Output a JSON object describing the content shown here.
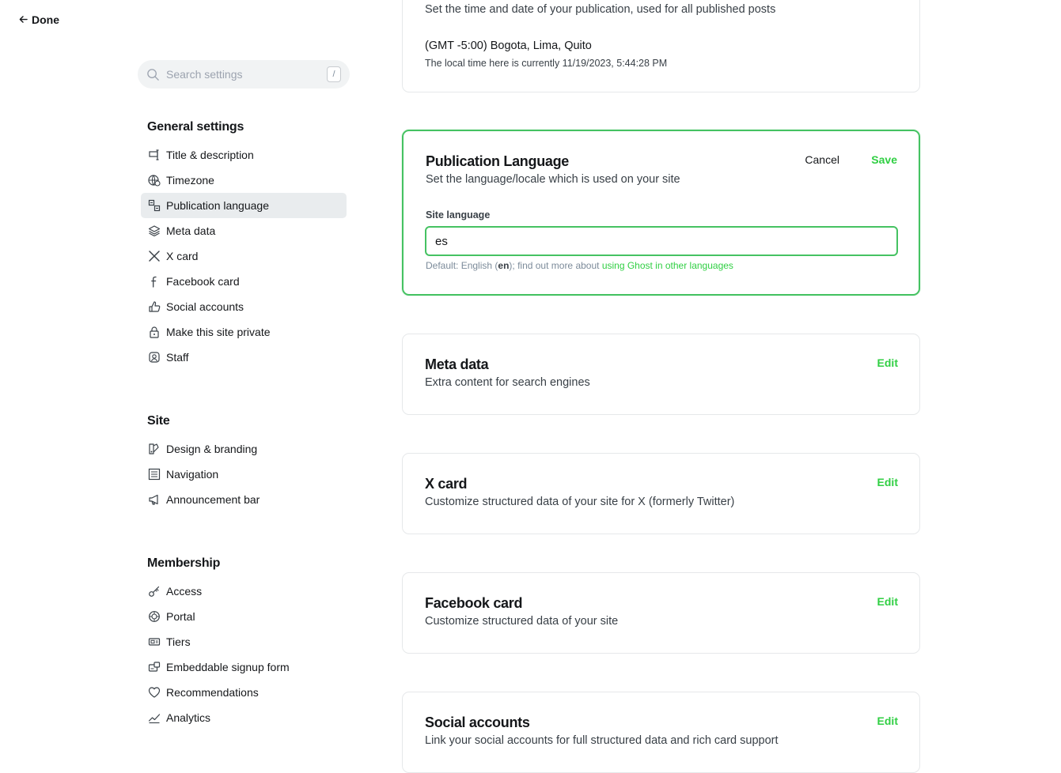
{
  "header": {
    "done_label": "Done"
  },
  "search": {
    "placeholder": "Search settings",
    "shortcut": "/"
  },
  "sidebar": {
    "groups": [
      {
        "title": "General settings",
        "items": [
          {
            "label": "Title & description",
            "icon": "title-icon"
          },
          {
            "label": "Timezone",
            "icon": "globe-clock-icon"
          },
          {
            "label": "Publication language",
            "icon": "translate-icon",
            "active": true
          },
          {
            "label": "Meta data",
            "icon": "layers-icon"
          },
          {
            "label": "X card",
            "icon": "x-logo-icon"
          },
          {
            "label": "Facebook card",
            "icon": "facebook-icon"
          },
          {
            "label": "Social accounts",
            "icon": "thumbs-up-icon"
          },
          {
            "label": "Make this site private",
            "icon": "lock-icon"
          },
          {
            "label": "Staff",
            "icon": "staff-icon"
          }
        ]
      },
      {
        "title": "Site",
        "items": [
          {
            "label": "Design & branding",
            "icon": "brush-icon"
          },
          {
            "label": "Navigation",
            "icon": "list-icon"
          },
          {
            "label": "Announcement bar",
            "icon": "megaphone-icon"
          }
        ]
      },
      {
        "title": "Membership",
        "items": [
          {
            "label": "Access",
            "icon": "key-icon"
          },
          {
            "label": "Portal",
            "icon": "portal-icon"
          },
          {
            "label": "Tiers",
            "icon": "ticket-icon"
          },
          {
            "label": "Embeddable signup form",
            "icon": "embed-icon"
          },
          {
            "label": "Recommendations",
            "icon": "heart-icon"
          },
          {
            "label": "Analytics",
            "icon": "chart-icon"
          }
        ]
      }
    ]
  },
  "timezone_card": {
    "description": "Set the time and date of your publication, used for all published posts",
    "value": "(GMT -5:00) Bogota, Lima, Quito",
    "local_time": "The local time here is currently 11/19/2023, 5:44:28 PM"
  },
  "language_card": {
    "title": "Publication Language",
    "description": "Set the language/locale which is used on your site",
    "cancel_label": "Cancel",
    "save_label": "Save",
    "field_label": "Site language",
    "field_value": "es",
    "hint_prefix": "Default: English (",
    "hint_code": "en",
    "hint_middle": "); find out more about ",
    "hint_link": "using Ghost in other languages"
  },
  "cards": [
    {
      "title": "Meta data",
      "description": "Extra content for search engines",
      "action": "Edit"
    },
    {
      "title": "X card",
      "description": "Customize structured data of your site for X (formerly Twitter)",
      "action": "Edit"
    },
    {
      "title": "Facebook card",
      "description": "Customize structured data of your site",
      "action": "Edit"
    },
    {
      "title": "Social accounts",
      "description": "Link your social accounts for full structured data and rich card support",
      "action": "Edit"
    }
  ],
  "colors": {
    "accent": "#30cf43",
    "focus_border": "#45c262",
    "active_nav_bg": "#e9ecee"
  }
}
